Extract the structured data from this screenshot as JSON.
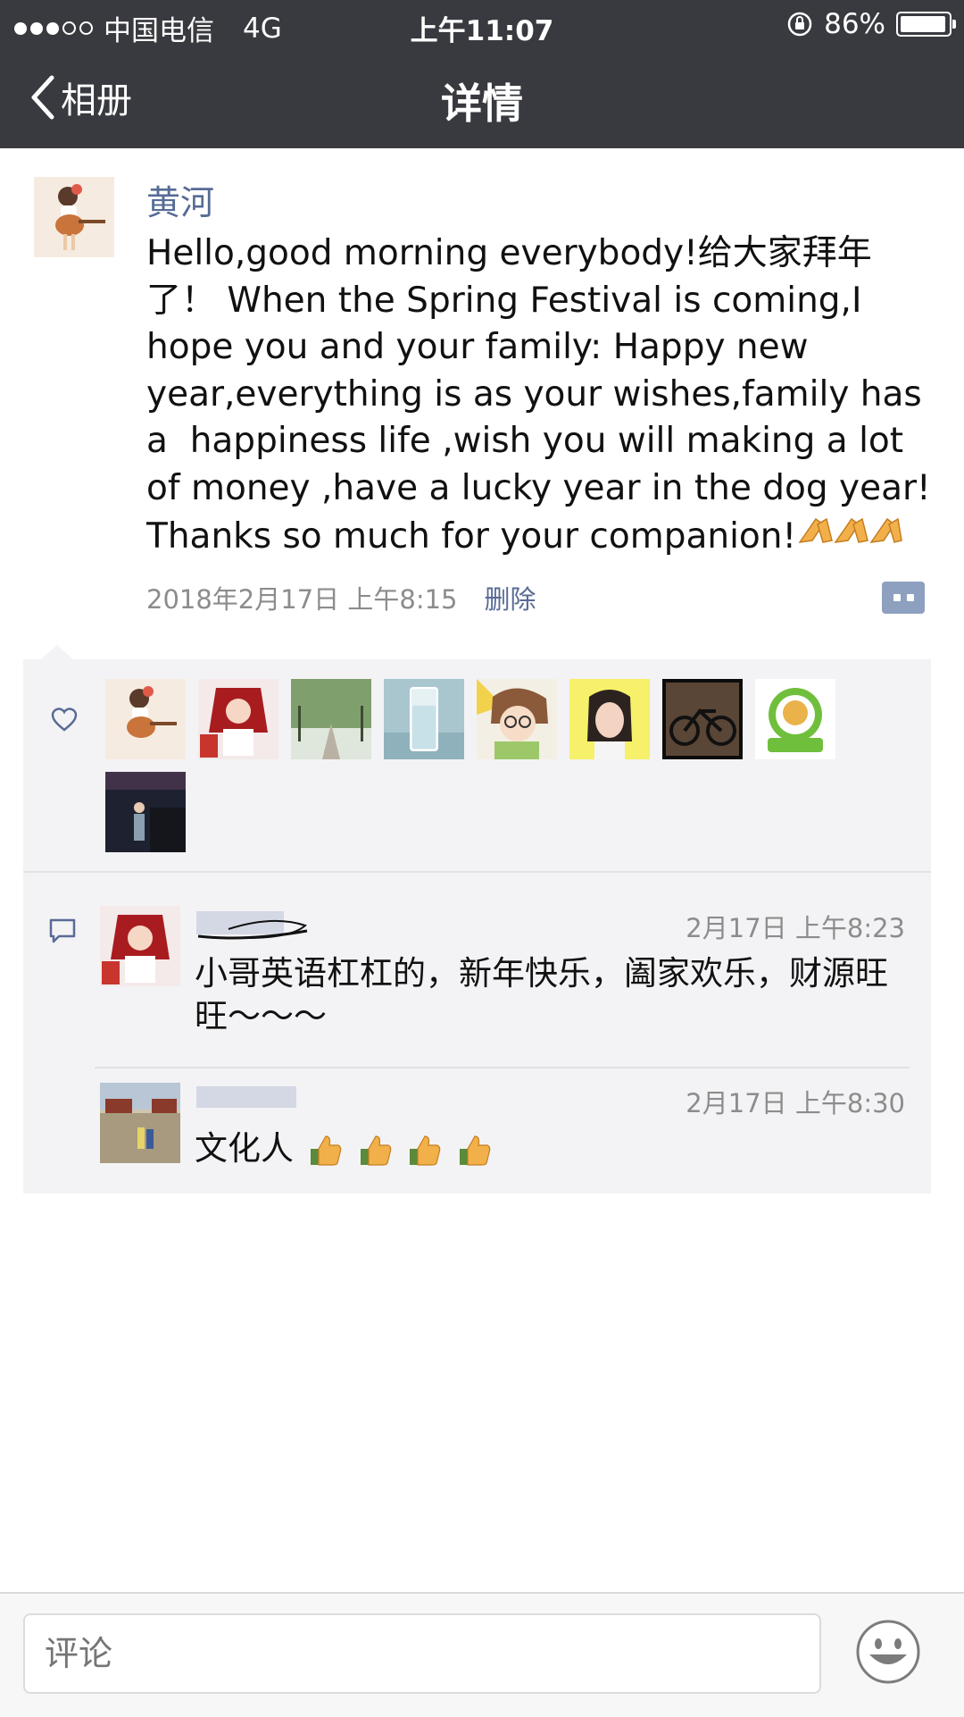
{
  "status_bar": {
    "carrier": "中国电信",
    "network": "4G",
    "time": "上午11:07",
    "battery": "86%",
    "battery_level": 0.86
  },
  "nav": {
    "back_label": "相册",
    "title": "详情"
  },
  "post": {
    "author": "黄河",
    "text": "Hello,good morning everybody!给大家拜年了！ When the Spring Festival is coming,I hope you and your family: Happy new year,everything is as your wishes,family has a  happiness life ,wish you will making a lot of money ,have a lucky year in the dog year! Thanks so much for your companion!",
    "timestamp": "2018年2月17日 上午8:15",
    "delete_label": "删除"
  },
  "likes": {
    "avatars": [
      "guitar-girl-avatar",
      "anime-girl-avatar",
      "tree-road-avatar",
      "water-glass-avatar",
      "cartoon-girl-avatar",
      "selfie-girl-avatar",
      "bicycle-avatar",
      "green-logo-avatar",
      "night-street-avatar"
    ]
  },
  "comments": [
    {
      "author": "",
      "time": "2月17日 上午8:23",
      "text": "小哥英语杠杠的，新年快乐，阖家欢乐，财源旺旺～～～"
    },
    {
      "author": "",
      "time": "2月17日 上午8:30",
      "text": "文化人"
    }
  ],
  "input": {
    "placeholder": "评论"
  },
  "colors": {
    "nav_bg": "#393a3f",
    "link": "#576b95",
    "panel_bg": "#f3f3f5",
    "meta_gray": "#8c8c8c"
  }
}
